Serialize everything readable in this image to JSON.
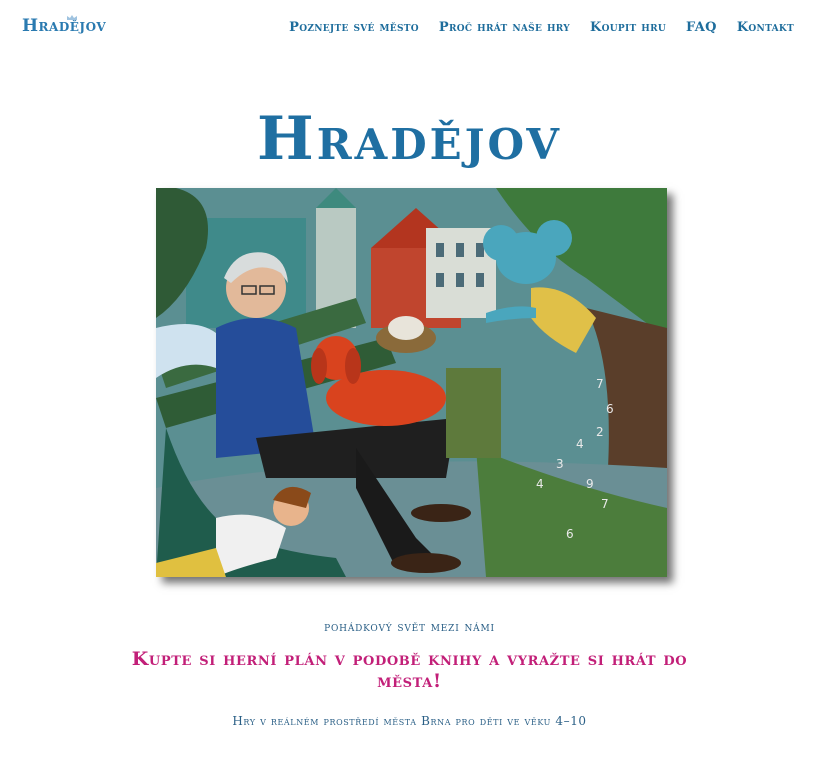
{
  "header": {
    "logo_text": "Hradějov",
    "nav": [
      {
        "label": "Poznejte své město"
      },
      {
        "label": "Proč hrát naše hry"
      },
      {
        "label": "Koupit hru"
      },
      {
        "label": "FAQ"
      },
      {
        "label": "Kontakt"
      }
    ]
  },
  "hero": {
    "title": "Hradějov",
    "tagline": "pohádkový svět mezi námi",
    "cta": "Kupte si herní plán v podobě knihy a vyražte si hrát do města!",
    "subline": "Hry v reálném prostředí města Brna pro děti ve věku 4–10"
  },
  "colors": {
    "brand_blue": "#1f6fa2",
    "accent_magenta": "#c21f78"
  }
}
